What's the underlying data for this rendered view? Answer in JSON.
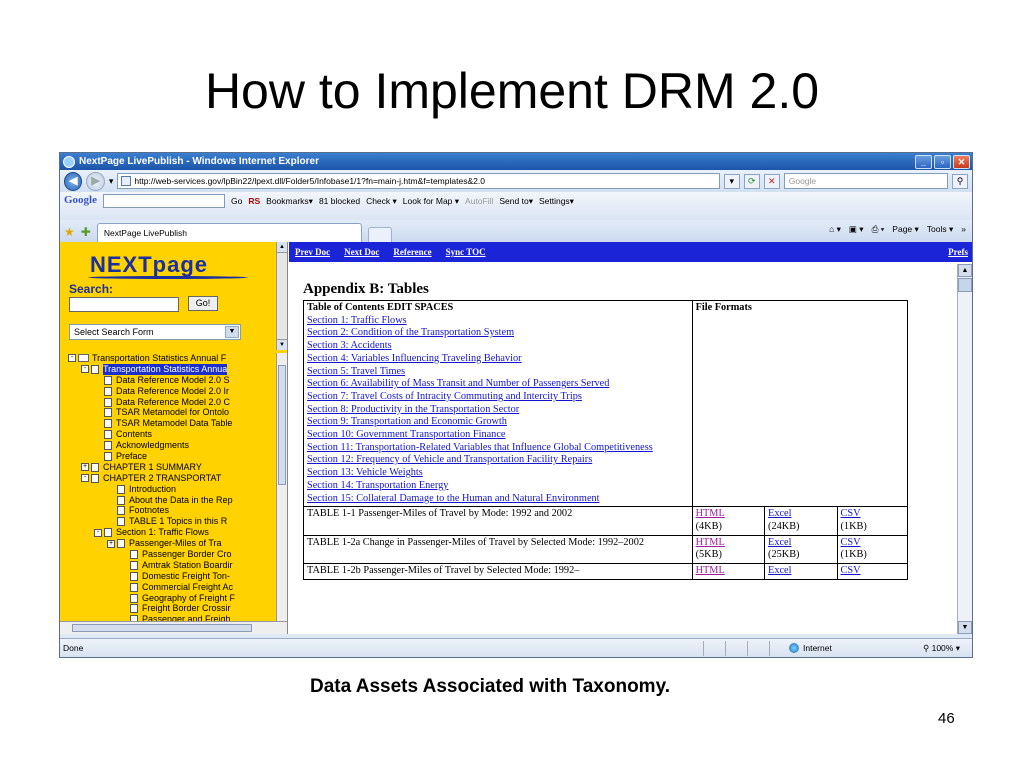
{
  "slide": {
    "title": "How to Implement DRM 2.0",
    "caption": "Data Assets Associated with Taxonomy.",
    "page_number": "46"
  },
  "browser": {
    "window_title": "NextPage LivePublish - Windows Internet Explorer",
    "address": "http://web-services.gov/lpBin22/lpext.dll/Folder5/Infobase1/1?fn=main-j.htm&f=templates&2.0",
    "search_placeholder": "Google",
    "tab_label": "NextPage LivePublish",
    "status_text": "Done",
    "zone": "Internet",
    "zoom": "100%",
    "tab_tools": [
      "Page ▾",
      "Tools ▾"
    ],
    "google_toolbar": {
      "logo": "Google",
      "items": [
        "Go",
        "RS",
        "Bookmarks▾",
        "81 blocked",
        "Check ▾",
        "Look for Map ▾",
        "AutoFill",
        "Send to▾",
        "Settings▾"
      ]
    }
  },
  "left_pane": {
    "logo": "NEXTpage",
    "search_label": "Search:",
    "go_button": "Go!",
    "select_label": "Select Search Form",
    "tree": [
      {
        "label": "Transportation Statistics Annual F",
        "level": 0,
        "exp": "-",
        "type": "folder"
      },
      {
        "label": "Transportation Statistics Annua",
        "level": 1,
        "exp": "-",
        "type": "doc",
        "selected": true
      },
      {
        "label": "Data Reference Model 2.0 S",
        "level": 2,
        "exp": "",
        "type": "doc"
      },
      {
        "label": "Data Reference Model 2.0 Ir",
        "level": 2,
        "exp": "",
        "type": "doc"
      },
      {
        "label": "Data Reference Model 2.0 C",
        "level": 2,
        "exp": "",
        "type": "doc"
      },
      {
        "label": "TSAR Metamodel for Ontolo",
        "level": 2,
        "exp": "",
        "type": "doc"
      },
      {
        "label": "TSAR Metamodel Data Table",
        "level": 2,
        "exp": "",
        "type": "doc"
      },
      {
        "label": "Contents",
        "level": 2,
        "exp": "",
        "type": "doc"
      },
      {
        "label": "Acknowledgments",
        "level": 2,
        "exp": "",
        "type": "doc"
      },
      {
        "label": "Preface",
        "level": 2,
        "exp": "",
        "type": "doc"
      },
      {
        "label": "CHAPTER 1 SUMMARY",
        "level": 1,
        "exp": "+",
        "type": "doc"
      },
      {
        "label": "CHAPTER 2 TRANSPORTAT",
        "level": 1,
        "exp": "-",
        "type": "doc"
      },
      {
        "label": "Introduction",
        "level": 3,
        "exp": "",
        "type": "doc"
      },
      {
        "label": "About the Data in the Rep",
        "level": 3,
        "exp": "",
        "type": "doc"
      },
      {
        "label": "Footnotes",
        "level": 3,
        "exp": "",
        "type": "doc"
      },
      {
        "label": "TABLE 1  Topics in this R",
        "level": 3,
        "exp": "",
        "type": "doc"
      },
      {
        "label": "Section 1: Traffic Flows",
        "level": 2,
        "exp": "-",
        "type": "doc"
      },
      {
        "label": "Passenger-Miles of Tra",
        "level": 3,
        "exp": "+",
        "type": "doc"
      },
      {
        "label": "Passenger Border Cro",
        "level": 4,
        "exp": "",
        "type": "doc"
      },
      {
        "label": "Amtrak Station Boardir",
        "level": 4,
        "exp": "",
        "type": "doc"
      },
      {
        "label": "Domestic Freight Ton-",
        "level": 4,
        "exp": "",
        "type": "doc"
      },
      {
        "label": "Commercial Freight Ac",
        "level": 4,
        "exp": "",
        "type": "doc"
      },
      {
        "label": "Geography of Freight F",
        "level": 4,
        "exp": "",
        "type": "doc"
      },
      {
        "label": "Freight Border Crossir",
        "level": 4,
        "exp": "",
        "type": "doc"
      },
      {
        "label": "Passenger and Freigh",
        "level": 4,
        "exp": "",
        "type": "doc"
      }
    ]
  },
  "right_pane": {
    "nav_links": [
      "Prev Doc",
      "Next Doc",
      "Reference",
      "Sync TOC"
    ],
    "prefs": "Prefs",
    "heading": "Appendix B: Tables",
    "toc_header": "Table of Contents EDIT SPACES",
    "formats_header": "File Formats",
    "toc_links": [
      "Section 1: Traffic Flows",
      "Section 2: Condition of the Transportation System",
      "Section 3: Accidents",
      "Section 4: Variables Influencing Traveling Behavior",
      "Section 5: Travel Times",
      "Section 6: Availability of Mass Transit and Number of Passengers Served",
      "Section 7: Travel Costs of Intracity Commuting and Intercity Trips",
      "Section 8: Productivity in the Transportation Sector",
      "Section 9: Transportation and Economic Growth",
      "Section 10: Government Transportation Finance",
      "Section 11: Transportation-Related Variables that Influence Global Competitiveness",
      "Section 12: Frequency of Vehicle and Transportation Facility Repairs",
      "Section 13: Vehicle Weights",
      "Section 14: Transportation Energy",
      "Section 15: Collateral Damage to the Human and Natural Environment"
    ],
    "rows": [
      {
        "title": "TABLE 1-1 Passenger-Miles of Travel by Mode: 1992 and 2002",
        "html": "HTML",
        "html_size": "(4KB)",
        "excel": "Excel",
        "excel_size": "(24KB)",
        "csv": "CSV",
        "csv_size": "(1KB)"
      },
      {
        "title": "TABLE 1-2a Change in Passenger-Miles of Travel by Selected Mode: 1992–2002",
        "html": "HTML",
        "html_size": "(5KB)",
        "excel": "Excel",
        "excel_size": "(25KB)",
        "csv": "CSV",
        "csv_size": "(1KB)"
      },
      {
        "title": "TABLE 1-2b Passenger-Miles of Travel by Selected Mode: 1992–",
        "html": "HTML",
        "html_size": "",
        "excel": "Excel",
        "excel_size": "",
        "csv": "CSV",
        "csv_size": ""
      }
    ]
  }
}
